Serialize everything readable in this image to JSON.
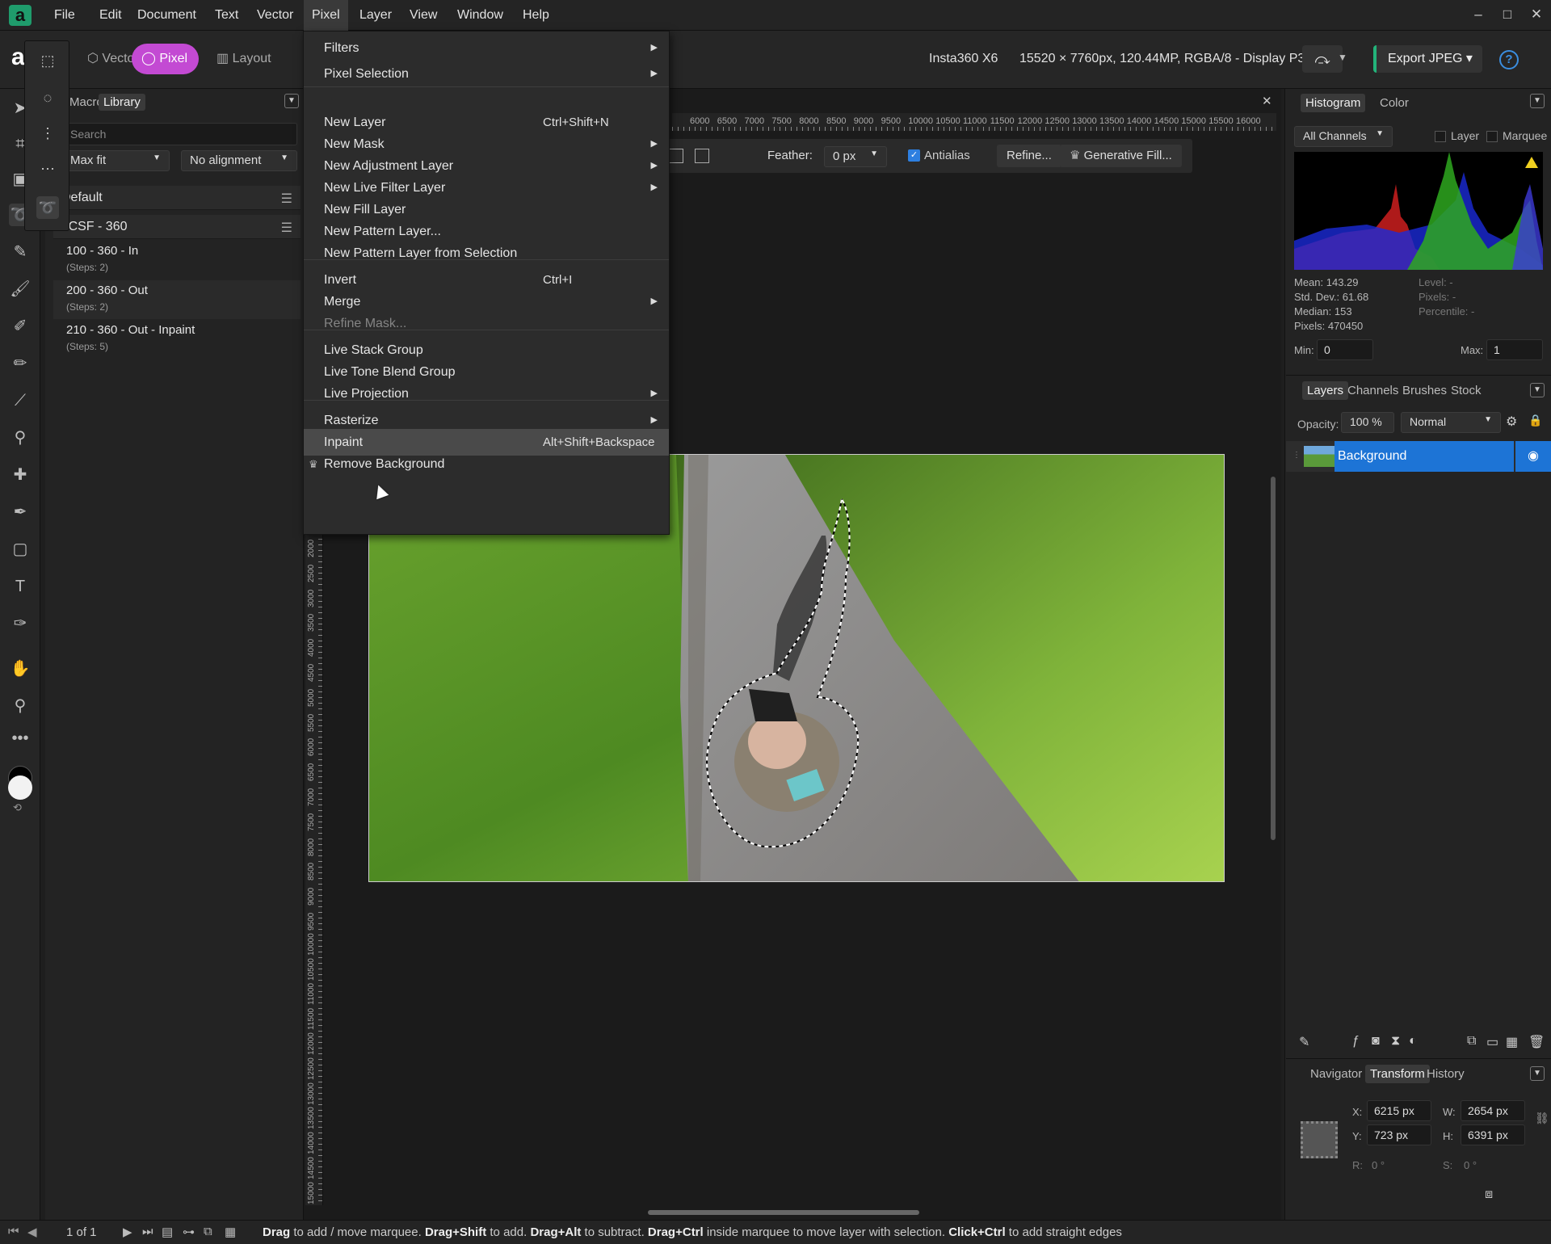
{
  "menubar": {
    "items": [
      "File",
      "Edit",
      "Document",
      "Text",
      "Vector",
      "Pixel",
      "Layer",
      "View",
      "Window",
      "Help"
    ],
    "active": "Pixel"
  },
  "toolbar": {
    "personas": [
      "Vector",
      "Pixel",
      "Layout"
    ],
    "active_persona": "Pixel",
    "camera": "Insta360 X6",
    "doc_info": "15520 × 7760px, 120.44MP, RGBA/8 - Display P3",
    "export_label": "Export JPEG"
  },
  "left_panel": {
    "tabs": [
      "Macro",
      "Library"
    ],
    "active_tab": "Library",
    "search_placeholder": "Search",
    "fit_value": "Max fit",
    "alignment_value": "No alignment",
    "groups": [
      {
        "name": "Default"
      },
      {
        "name": "CSF - 360",
        "macros": [
          {
            "name": "100 - 360 - In",
            "steps": "(Steps: 2)"
          },
          {
            "name": "200 - 360 - Out",
            "steps": "(Steps: 2)"
          },
          {
            "name": "210 - 360 - Out - Inpaint",
            "steps": "(Steps: 5)"
          }
        ]
      }
    ]
  },
  "context_toolbar": {
    "feather_label": "Feather:",
    "feather_value": "0 px",
    "antialias_label": "Antialias",
    "refine_label": "Refine...",
    "generative_fill_label": "Generative Fill..."
  },
  "ruler": {
    "h_ticks": [
      "6000",
      "6500",
      "7000",
      "7500",
      "8000",
      "8500",
      "9000",
      "9500",
      "10000",
      "10500",
      "11000",
      "11500",
      "12000",
      "12500",
      "13000",
      "13500",
      "14000",
      "14500",
      "15000",
      "15500",
      "16000"
    ],
    "v_ticks": [
      "2000",
      "2500",
      "3000",
      "3500",
      "4000",
      "4500",
      "5000",
      "5500",
      "6000",
      "6500",
      "7000",
      "7500",
      "8000",
      "8500",
      "9000",
      "9500",
      "10000",
      "10500",
      "11000",
      "11500",
      "12000",
      "12500",
      "13000",
      "13500",
      "14000",
      "14500",
      "15000"
    ]
  },
  "pixel_menu": {
    "items": [
      {
        "label": "Filters",
        "shortcut": "",
        "submenu": true
      },
      {
        "label": "Pixel Selection",
        "shortcut": "",
        "submenu": true
      },
      {
        "label": "New Layer",
        "shortcut": "Ctrl+Shift+N",
        "submenu": false
      },
      {
        "label": "New Mask",
        "shortcut": "",
        "submenu": true
      },
      {
        "label": "New Adjustment Layer",
        "shortcut": "",
        "submenu": true
      },
      {
        "label": "New Live Filter Layer",
        "shortcut": "",
        "submenu": true
      },
      {
        "label": "New Fill Layer",
        "shortcut": "",
        "submenu": false
      },
      {
        "label": "New Pattern Layer...",
        "shortcut": "",
        "submenu": false
      },
      {
        "label": "New Pattern Layer from Selection",
        "shortcut": "",
        "submenu": false
      },
      {
        "label": "Invert",
        "shortcut": "Ctrl+I",
        "submenu": false
      },
      {
        "label": "Merge",
        "shortcut": "",
        "submenu": true
      },
      {
        "label": "Refine Mask...",
        "shortcut": "",
        "submenu": false,
        "disabled": true
      },
      {
        "label": "Live Stack Group",
        "shortcut": "",
        "submenu": false
      },
      {
        "label": "Live Tone Blend Group",
        "shortcut": "",
        "submenu": false
      },
      {
        "label": "Live Projection",
        "shortcut": "",
        "submenu": true
      },
      {
        "label": "Rasterize",
        "shortcut": "",
        "submenu": true
      },
      {
        "label": "Inpaint",
        "shortcut": "Alt+Shift+Backspace",
        "submenu": false,
        "highlighted": true
      },
      {
        "label": "Remove Background",
        "shortcut": "",
        "submenu": false,
        "crown": true
      }
    ]
  },
  "histogram": {
    "tabs": [
      "Histogram",
      "Color"
    ],
    "active_tab": "Histogram",
    "channel": "All Channels",
    "layer_label": "Layer",
    "marquee_label": "Marquee",
    "stats": [
      "Mean: 143.29",
      "Std. Dev.: 61.68",
      "Median: 153",
      "Pixels: 470450"
    ],
    "stats_right": [
      "Level: -",
      "Pixels: -",
      "Percentile: -"
    ],
    "min_label": "Min:",
    "min_value": "0",
    "max_label": "Max:",
    "max_value": "1"
  },
  "layers": {
    "tabs": [
      "Layers",
      "Channels",
      "Brushes",
      "Stock"
    ],
    "active_tab": "Layers",
    "opacity_label": "Opacity:",
    "opacity_value": "100 %",
    "blend_mode": "Normal",
    "items": [
      {
        "name": "Background"
      }
    ]
  },
  "transform": {
    "tabs": [
      "Navigator",
      "Transform",
      "History"
    ],
    "active_tab": "Transform",
    "x_label": "X:",
    "x": "6215 px",
    "y_label": "Y:",
    "y": "723 px",
    "w_label": "W:",
    "w": "2654 px",
    "h_label": "H:",
    "h": "6391 px",
    "r_label": "R:",
    "r": "0 °",
    "s_label": "S:",
    "s": "0 °"
  },
  "statusbar": {
    "page": "1 of 1",
    "hint_parts": [
      {
        "b": "Drag",
        "t": " to add / move marquee. "
      },
      {
        "b": "Drag+Shift",
        "t": " to add. "
      },
      {
        "b": "Drag+Alt",
        "t": " to subtract. "
      },
      {
        "b": "Drag+Ctrl",
        "t": " inside marquee to move layer with selection. "
      },
      {
        "b": "Click+Ctrl",
        "t": " to add straight edges"
      }
    ]
  },
  "colors": {
    "accent": "#c34ad3",
    "selection": "#1d74d6",
    "export_green": "#23b37a"
  }
}
